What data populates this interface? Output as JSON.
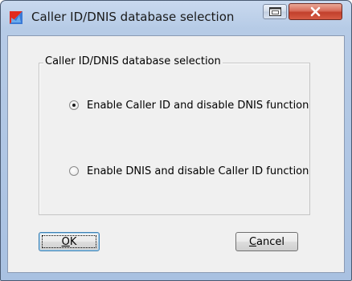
{
  "window": {
    "title": "Caller ID/DNIS database selection",
    "app_icon": "red-blue-flag-icon",
    "controls": {
      "restore_icon": "restore-icon",
      "close_icon": "close-x-icon"
    }
  },
  "group": {
    "legend": "Caller ID/DNIS database selection",
    "options": [
      {
        "label": "Enable Caller ID and disable DNIS function",
        "selected": true
      },
      {
        "label": "Enable DNIS and disable Caller ID function",
        "selected": false
      }
    ]
  },
  "buttons": {
    "ok": {
      "mnemonic": "O",
      "rest": "K"
    },
    "cancel": {
      "mnemonic": "C",
      "rest": "ancel"
    }
  },
  "colors": {
    "close_button": "#c2402c",
    "dialog_bg": "#f0f0f0",
    "frame": "#b6cbe6"
  }
}
